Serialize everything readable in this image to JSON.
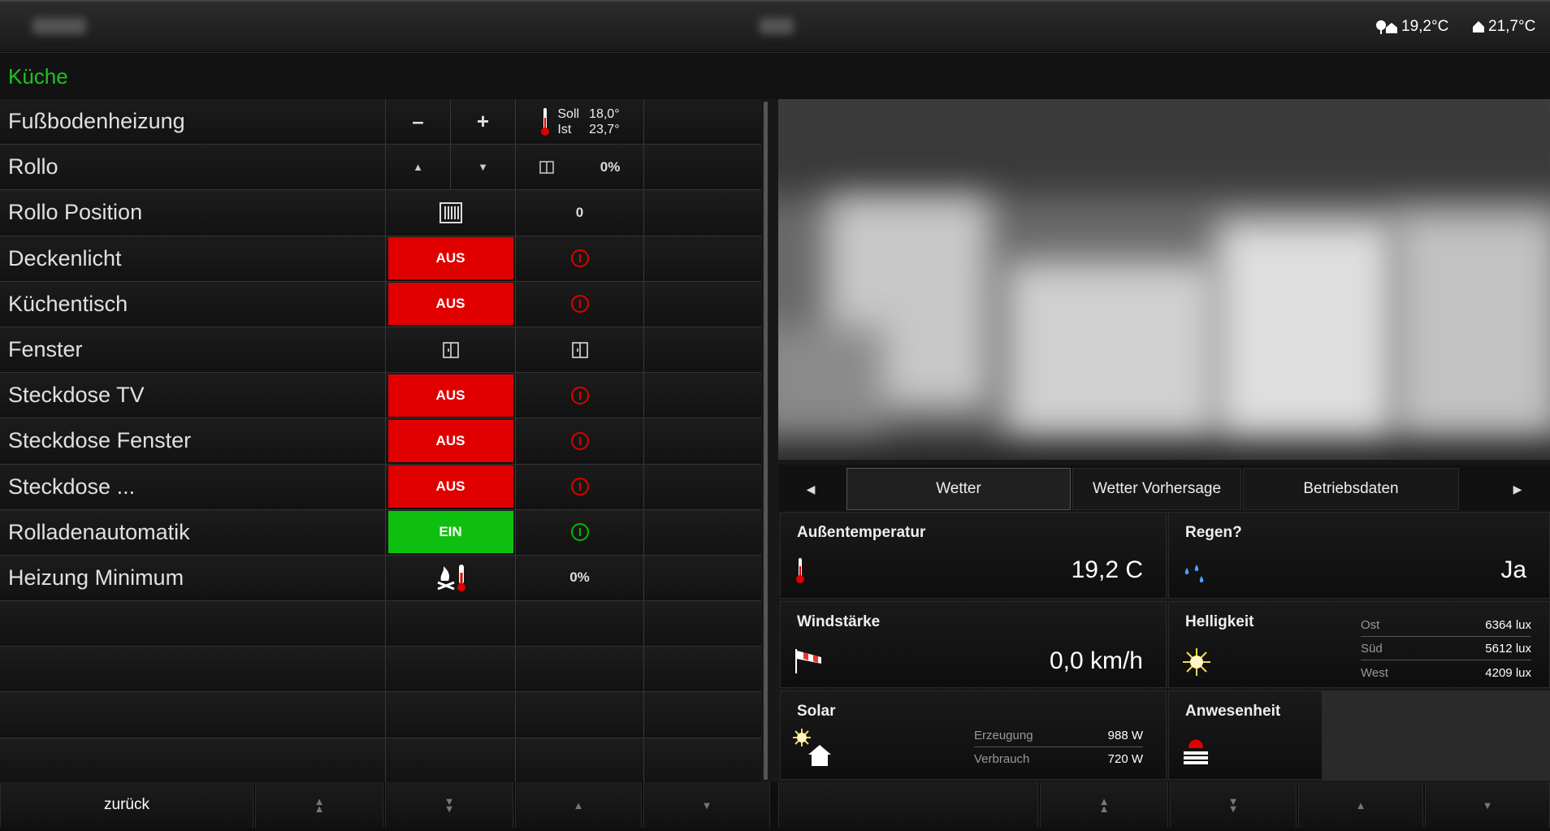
{
  "topbar": {
    "outdoor_temp": "19,2°C",
    "indoor_temp": "21,7°C"
  },
  "room": {
    "title": "Küche"
  },
  "rows": [
    {
      "label": "Fußbodenheizung",
      "minus": "–",
      "plus": "+",
      "soll_label": "Soll",
      "soll_value": "18,0°",
      "ist_label": "Ist",
      "ist_value": "23,7°"
    },
    {
      "label": "Rollo",
      "value": "0%"
    },
    {
      "label": "Rollo Position",
      "value": "0"
    },
    {
      "label": "Deckenlicht",
      "state": "AUS"
    },
    {
      "label": "Küchentisch",
      "state": "AUS"
    },
    {
      "label": "Fenster"
    },
    {
      "label": "Steckdose TV",
      "state": "AUS"
    },
    {
      "label": "Steckdose Fenster",
      "state": "AUS"
    },
    {
      "label": "Steckdose ...",
      "state": "AUS"
    },
    {
      "label": "Rolladenautomatik",
      "state": "EIN"
    },
    {
      "label": "Heizung Minimum",
      "value": "0%"
    }
  ],
  "tabs": {
    "items": [
      "Wetter",
      "Wetter Vorhersage",
      "Betriebsdaten"
    ],
    "active": "Wetter"
  },
  "weather": {
    "temp_title": "Außentemperatur",
    "temp_value": "19,2 C",
    "rain_title": "Regen?",
    "rain_value": "Ja",
    "wind_title": "Windstärke",
    "wind_value": "0,0 km/h",
    "light_title": "Helligkeit",
    "light": [
      {
        "dir": "Ost",
        "value": "6364 lux"
      },
      {
        "dir": "Süd",
        "value": "5612 lux"
      },
      {
        "dir": "West",
        "value": "4209 lux"
      }
    ],
    "solar_title": "Solar",
    "solar": [
      {
        "label": "Erzeugung",
        "value": "988 W"
      },
      {
        "label": "Verbrauch",
        "value": "720 W"
      }
    ],
    "presence_title": "Anwesenheit"
  },
  "footer": {
    "back_label": "zurück"
  },
  "colors": {
    "accent_green": "#1fc21f",
    "off_red": "#e00000",
    "on_green": "#0fbf0f"
  }
}
